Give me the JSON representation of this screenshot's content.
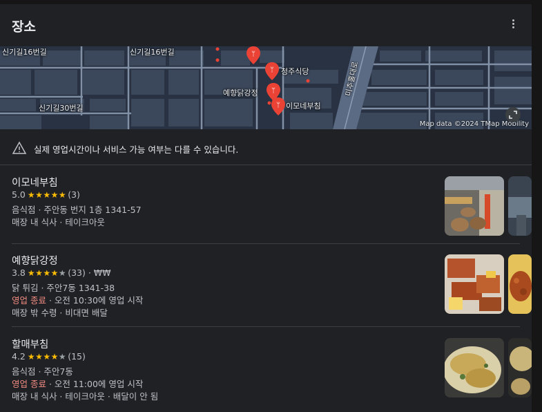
{
  "header": {
    "title": "장소"
  },
  "map": {
    "labels": {
      "street_1": "신기길16번길",
      "street_2": "신기길16번길",
      "street_3": "신기길30번길",
      "place_1": "청주식당",
      "place_2": "예향닭강정",
      "place_3": "이모네부침",
      "road": "미추홀대로"
    },
    "attribution": "Map data ©2024 TMap Mobility"
  },
  "notice": {
    "text": "실제 영업시간이나 서비스 가능 여부는 다를 수 있습니다."
  },
  "places": [
    {
      "name": "이모네부침",
      "rating": "5.0",
      "stars_filled": 5,
      "review_count": "(3)",
      "price": "",
      "category_address": "음식점 · 주안동 번지 1층 1341-57",
      "status": "",
      "hours": "",
      "services": "매장 내 식사 · 테이크아웃"
    },
    {
      "name": "예향닭강정",
      "rating": "3.8",
      "stars_filled": 4,
      "review_count": "(33)",
      "price": "₩₩",
      "category_address": "닭 튀김 · 주안7동 1341-38",
      "status": "영업 종료",
      "hours": "· 오전 10:30에 영업 시작",
      "services": "매장 밖 수령 · 비대면 배달"
    },
    {
      "name": "할매부침",
      "rating": "4.2",
      "stars_filled": 4,
      "review_count": "(15)",
      "price": "",
      "category_address": "음식점 · 주안7동",
      "status": "영업 종료",
      "hours": "· 오전 11:00에 영업 시작",
      "services": "매장 내 식사 · 테이크아웃 · 배달이 안 됨"
    }
  ],
  "colors": {
    "star": "#fbbc04",
    "closed": "#f28b82",
    "pin": "#ea4335",
    "background": "#202124"
  }
}
